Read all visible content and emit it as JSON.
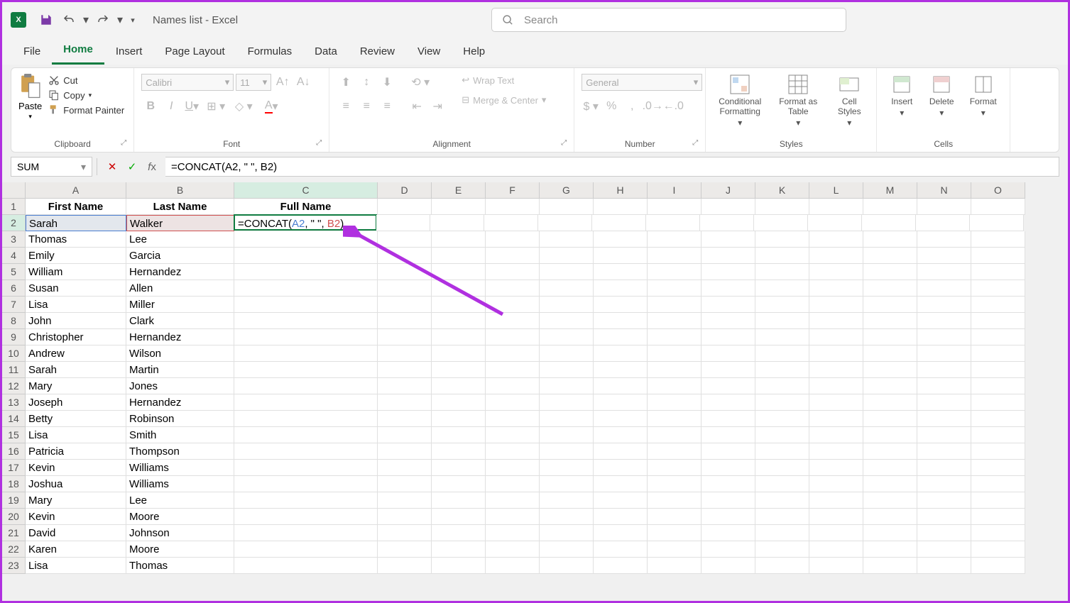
{
  "title": "Names list - Excel",
  "search_placeholder": "Search",
  "tabs": [
    "File",
    "Home",
    "Insert",
    "Page Layout",
    "Formulas",
    "Data",
    "Review",
    "View",
    "Help"
  ],
  "active_tab": "Home",
  "ribbon": {
    "clipboard": {
      "title": "Clipboard",
      "paste": "Paste",
      "cut": "Cut",
      "copy": "Copy",
      "format_painter": "Format Painter"
    },
    "font": {
      "title": "Font",
      "font_name": "Calibri",
      "font_size": "11"
    },
    "alignment": {
      "title": "Alignment",
      "wrap": "Wrap Text",
      "merge": "Merge & Center"
    },
    "number": {
      "title": "Number",
      "format": "General"
    },
    "styles": {
      "title": "Styles",
      "conditional": "Conditional Formatting",
      "format_table": "Format as Table",
      "cell_styles": "Cell Styles"
    },
    "cells": {
      "title": "Cells",
      "insert": "Insert",
      "delete": "Delete",
      "format": "Format"
    }
  },
  "name_box": "SUM",
  "formula_bar": "=CONCAT(A2, \" \", B2)",
  "columns": [
    "A",
    "B",
    "C",
    "D",
    "E",
    "F",
    "G",
    "H",
    "I",
    "J",
    "K",
    "L",
    "M",
    "N",
    "O"
  ],
  "headers": {
    "a": "First Name",
    "b": "Last Name",
    "c": "Full Name"
  },
  "formula_parts": {
    "prefix": "=CONCAT(",
    "ref1": "A2",
    "sep1": ", \" \", ",
    "ref2": "B2",
    "suffix": ")"
  },
  "rows": [
    {
      "a": "Sarah",
      "b": "Walker"
    },
    {
      "a": "Thomas",
      "b": "Lee"
    },
    {
      "a": "Emily",
      "b": "Garcia"
    },
    {
      "a": "William",
      "b": "Hernandez"
    },
    {
      "a": "Susan",
      "b": "Allen"
    },
    {
      "a": "Lisa",
      "b": "Miller"
    },
    {
      "a": "John",
      "b": "Clark"
    },
    {
      "a": "Christopher",
      "b": "Hernandez"
    },
    {
      "a": "Andrew",
      "b": "Wilson"
    },
    {
      "a": "Sarah",
      "b": "Martin"
    },
    {
      "a": "Mary",
      "b": "Jones"
    },
    {
      "a": "Joseph",
      "b": "Hernandez"
    },
    {
      "a": "Betty",
      "b": "Robinson"
    },
    {
      "a": "Lisa",
      "b": "Smith"
    },
    {
      "a": "Patricia",
      "b": "Thompson"
    },
    {
      "a": "Kevin",
      "b": "Williams"
    },
    {
      "a": "Joshua",
      "b": "Williams"
    },
    {
      "a": "Mary",
      "b": "Lee"
    },
    {
      "a": "Kevin",
      "b": "Moore"
    },
    {
      "a": "David",
      "b": "Johnson"
    },
    {
      "a": "Karen",
      "b": "Moore"
    },
    {
      "a": "Lisa",
      "b": "Thomas"
    }
  ]
}
